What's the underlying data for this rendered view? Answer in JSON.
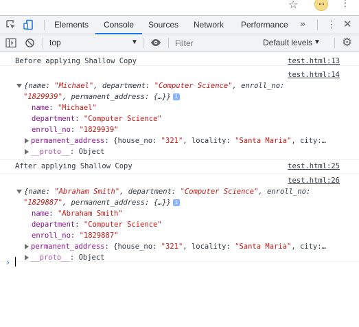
{
  "browser": {
    "star_icon": "star-outline-icon",
    "avatar_icon": "profile-avatar-icon",
    "menu_icon": "vertical-dots-icon"
  },
  "devtools": {
    "tabs": [
      "Elements",
      "Console",
      "Sources",
      "Network",
      "Performance"
    ],
    "active_tab": "Console",
    "more_tabs": "»"
  },
  "toolbar": {
    "context": "top",
    "filter_placeholder": "Filter",
    "levels": "Default levels"
  },
  "console": {
    "log1": {
      "text": "Before applying Shallow Copy",
      "source": "test.html:13"
    },
    "obj1": {
      "source": "test.html:14",
      "summary_l1_a": "{name: ",
      "summary_l1_name": "\"Michael\"",
      "summary_l1_b": ", department: ",
      "summary_l1_dept": "\"Computer Science\"",
      "summary_l1_c": ", enroll_no:",
      "summary_l2_enroll": "\"1829939\"",
      "summary_l2_rest": ", permanent_address: {…}}",
      "props": {
        "name_key": "name",
        "name_val": "\"Michael\"",
        "dept_key": "department",
        "dept_val": "\"Computer Science\"",
        "enroll_key": "enroll_no",
        "enroll_val": "\"1829939\"",
        "addr_key": "permanent_address",
        "addr_a": "{house_no: ",
        "addr_house": "\"321\"",
        "addr_b": ", locality: ",
        "addr_loc": "\"Santa Maria\"",
        "addr_c": ", city:…",
        "proto_key": "__proto__",
        "proto_val": "Object"
      }
    },
    "log2": {
      "text": "After applying Shallow Copy",
      "source": "test.html:25"
    },
    "obj2": {
      "source": "test.html:26",
      "summary_l1_a": "{name: ",
      "summary_l1_name": "\"Abraham Smith\"",
      "summary_l1_b": ", department: ",
      "summary_l1_dept": "\"Computer Science\"",
      "summary_l1_c": ", enroll_no:",
      "summary_l2_enroll": "\"1829887\"",
      "summary_l2_rest": ", permanent_address: {…}}",
      "props": {
        "name_key": "name",
        "name_val": "\"Abraham Smith\"",
        "dept_key": "department",
        "dept_val": "\"Computer Science\"",
        "enroll_key": "enroll_no",
        "enroll_val": "\"1829887\"",
        "addr_key": "permanent_address",
        "addr_a": "{house_no: ",
        "addr_house": "\"321\"",
        "addr_b": ", locality: ",
        "addr_loc": "\"Santa Maria\"",
        "addr_c": ", city:…",
        "proto_key": "__proto__",
        "proto_val": "Object"
      }
    },
    "prompt": "›",
    "info_badge": "i",
    "sep": ": "
  },
  "colors": {
    "key": "#881391",
    "string": "#c41a16",
    "accent": "#1a73e8"
  }
}
